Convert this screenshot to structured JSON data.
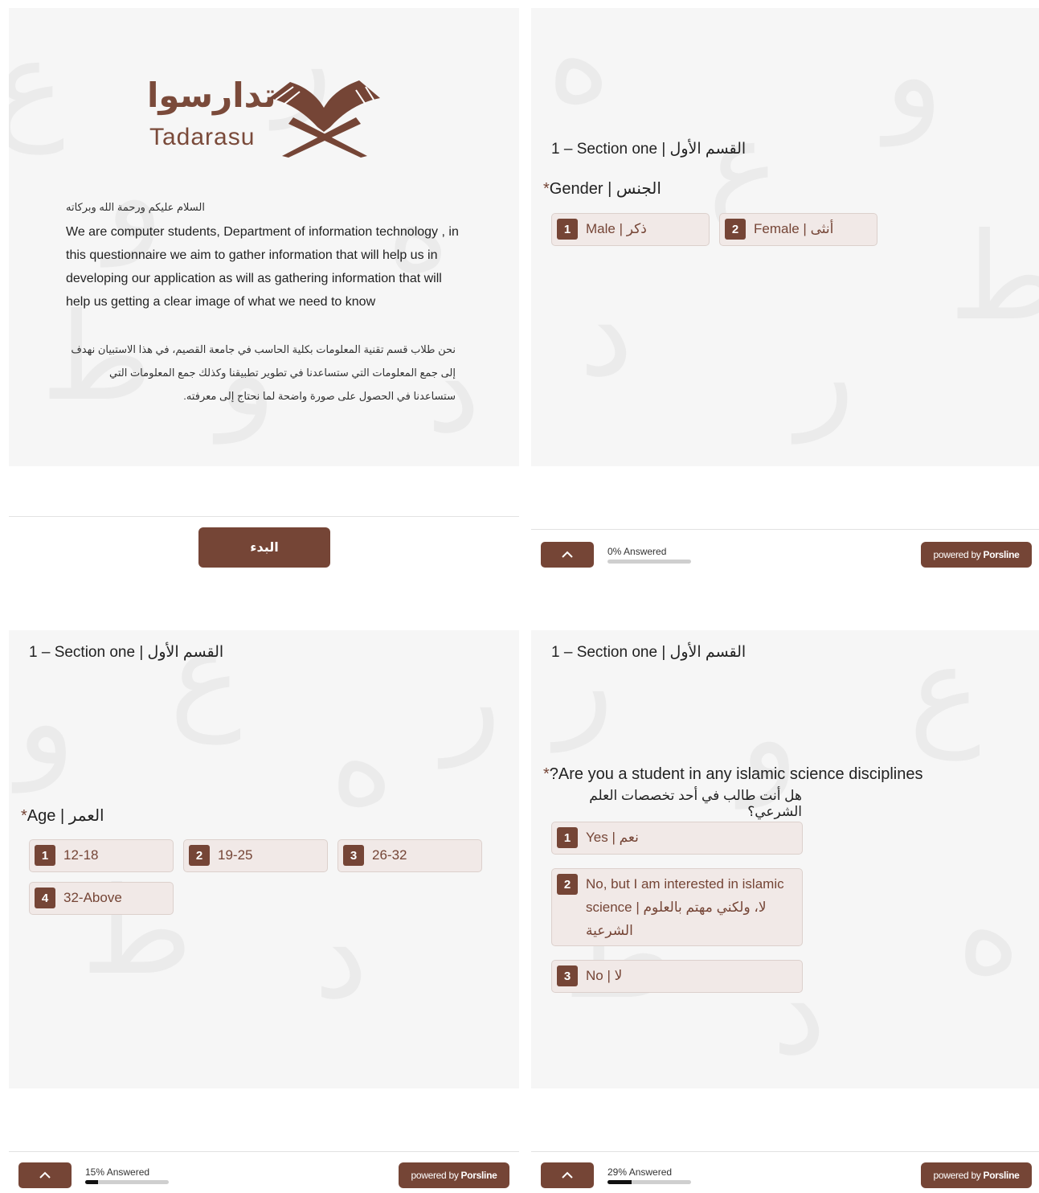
{
  "welcome": {
    "logo_ar": "تدارسوا",
    "logo_en": "Tadarasu",
    "greeting": "السلام عليكم ورحمة الله وبركاته",
    "intro_en": "We are computer students, Department of information technology , in this questionnaire we aim to gather information that will help us in developing our application as will as gathering information that will help us getting a clear image of what we need to know",
    "intro_ar": "نحن طلاب قسم تقنية المعلومات بكلية الحاسب في جامعة القصيم، في هذا الاستبيان نهدف إلى جمع المعلومات التي ستساعدنا في تطوير تطبيقنا وكذلك جمع المعلومات التي ستساعدنا في الحصول على صورة واضحة لما نحتاج إلى معرفته.",
    "start_button": "البدء"
  },
  "section_title": "1 – Section one | القسم الأول",
  "gender": {
    "star": "*",
    "label": "Gender | الجنس",
    "options": [
      {
        "key": "1",
        "label": "Male | ذكر"
      },
      {
        "key": "2",
        "label": "Female | أنثى"
      }
    ]
  },
  "age": {
    "star": "*",
    "label": "Age | العمر",
    "options": [
      {
        "key": "1",
        "label": "12-18"
      },
      {
        "key": "2",
        "label": "19-25"
      },
      {
        "key": "3",
        "label": "26-32"
      },
      {
        "key": "4",
        "label": "32-Above"
      }
    ]
  },
  "islamic": {
    "star": "*",
    "label": "?Are you a student in any islamic science disciplines",
    "label_ar": "هل أنت طالب في أحد تخصصات العلم الشرعي؟",
    "options": [
      {
        "key": "1",
        "label": "Yes | نعم"
      },
      {
        "key": "2",
        "label": "No, but I am interested in islamic science | لا، ولكني مهتم بالعلوم الشرعية"
      },
      {
        "key": "3",
        "label": "No | لا"
      }
    ]
  },
  "progress": {
    "p2": {
      "text": "0% Answered",
      "fraction": 0.0
    },
    "p3": {
      "text": "15% Answered",
      "fraction": 0.15
    },
    "p4": {
      "text": "29% Answered",
      "fraction": 0.29
    }
  },
  "powered": {
    "prefix": "powered by",
    "brand": "Porsline"
  },
  "icons": {
    "up": "chevron-up-icon"
  },
  "colors": {
    "accent": "#754536",
    "option_bg": "#f1e9e7"
  }
}
